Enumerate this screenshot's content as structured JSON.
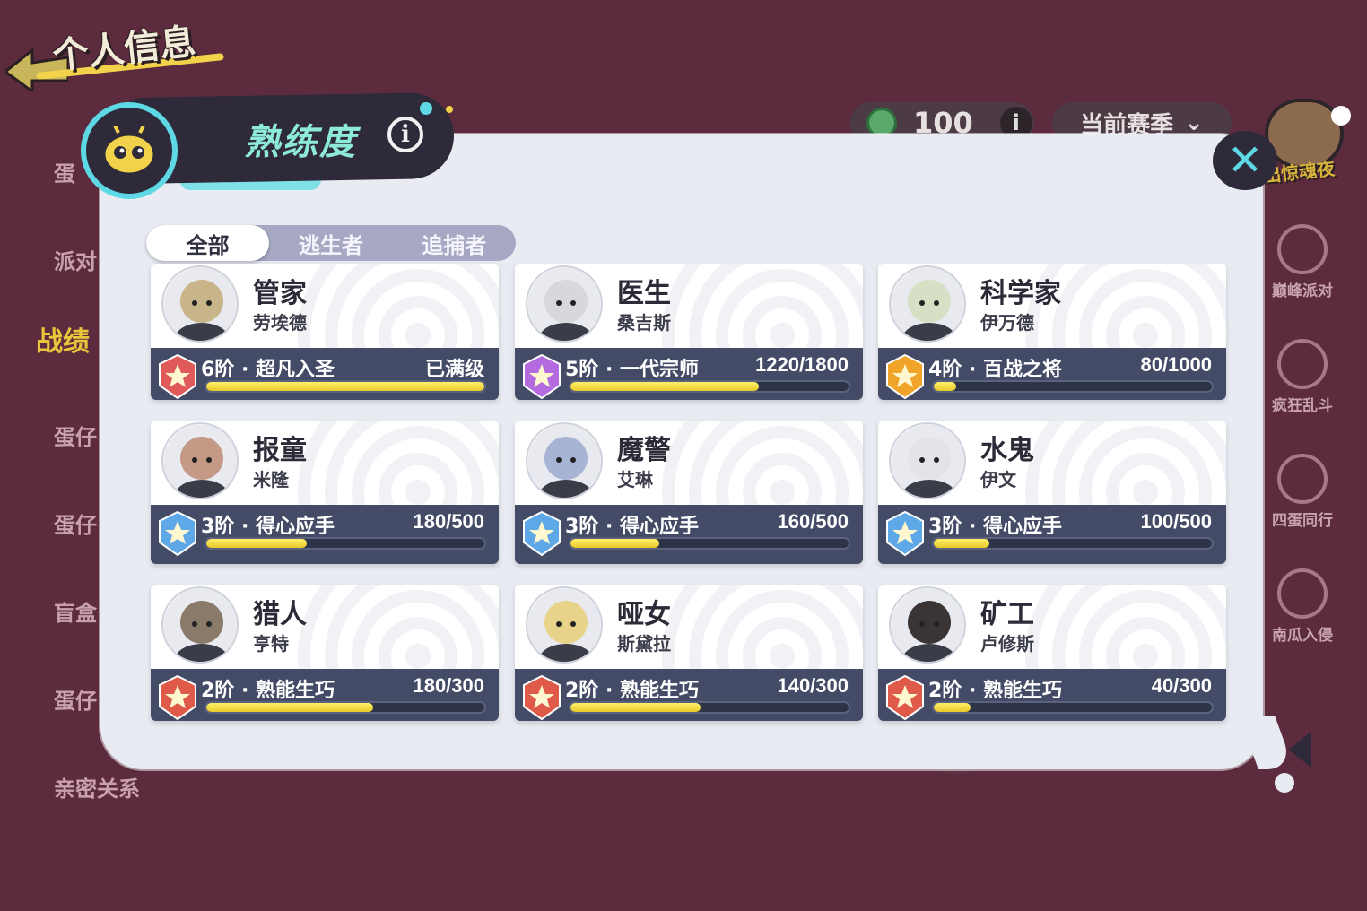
{
  "header": {
    "title": "个人信息"
  },
  "left_nav": {
    "items": [
      {
        "label": "蛋"
      },
      {
        "label": "派对"
      },
      {
        "label": "战绩",
        "active": true
      },
      {
        "label": "蛋仔"
      },
      {
        "label": "蛋仔"
      },
      {
        "label": "盲盒"
      },
      {
        "label": "蛋仔"
      },
      {
        "label": "亲密关系"
      }
    ]
  },
  "top_bar": {
    "coin_value": "100",
    "season_label": "当前赛季"
  },
  "right_nav": {
    "event_label": "出惊魂夜",
    "items": [
      {
        "label": "巅峰派对"
      },
      {
        "label": "疯狂乱斗"
      },
      {
        "label": "四蛋同行"
      },
      {
        "label": "南瓜入侵"
      }
    ]
  },
  "panel": {
    "title": "熟练度",
    "info_label": "i",
    "close_label": "✕",
    "tabs": [
      {
        "label": "全部",
        "active": true
      },
      {
        "label": "逃生者"
      },
      {
        "label": "追捕者"
      }
    ]
  },
  "cards": [
    {
      "name": "管家",
      "sub": "劳埃德",
      "rank": "6阶 · 超凡入圣",
      "value": "已满级",
      "progress": 1.0,
      "rank_color": "#e05a5a",
      "avatar_color": "#c9b58a"
    },
    {
      "name": "医生",
      "sub": "桑吉斯",
      "rank": "5阶 · 一代宗师",
      "value": "1220/1800",
      "progress": 0.678,
      "rank_color": "#b46be0",
      "avatar_color": "#d8d8dc"
    },
    {
      "name": "科学家",
      "sub": "伊万德",
      "rank": "4阶 · 百战之将",
      "value": "80/1000",
      "progress": 0.08,
      "rank_color": "#f0a52a",
      "avatar_color": "#d7e0c4"
    },
    {
      "name": "报童",
      "sub": "米隆",
      "rank": "3阶 · 得心应手",
      "value": "180/500",
      "progress": 0.36,
      "rank_color": "#5fa8e8",
      "avatar_color": "#c49a86"
    },
    {
      "name": "魔警",
      "sub": "艾琳",
      "rank": "3阶 · 得心应手",
      "value": "160/500",
      "progress": 0.32,
      "rank_color": "#5fa8e8",
      "avatar_color": "#a8b4d4"
    },
    {
      "name": "水鬼",
      "sub": "伊文",
      "rank": "3阶 · 得心应手",
      "value": "100/500",
      "progress": 0.2,
      "rank_color": "#5fa8e8",
      "avatar_color": "#e2e4ea"
    },
    {
      "name": "猎人",
      "sub": "亨特",
      "rank": "2阶 · 熟能生巧",
      "value": "180/300",
      "progress": 0.6,
      "rank_color": "#e05a4a",
      "avatar_color": "#8a7a6a"
    },
    {
      "name": "哑女",
      "sub": "斯黛拉",
      "rank": "2阶 · 熟能生巧",
      "value": "140/300",
      "progress": 0.467,
      "rank_color": "#e05a4a",
      "avatar_color": "#e8d38a"
    },
    {
      "name": "矿工",
      "sub": "卢修斯",
      "rank": "2阶 · 熟能生巧",
      "value": "40/300",
      "progress": 0.133,
      "rank_color": "#e05a4a",
      "avatar_color": "#3a3434"
    }
  ]
}
